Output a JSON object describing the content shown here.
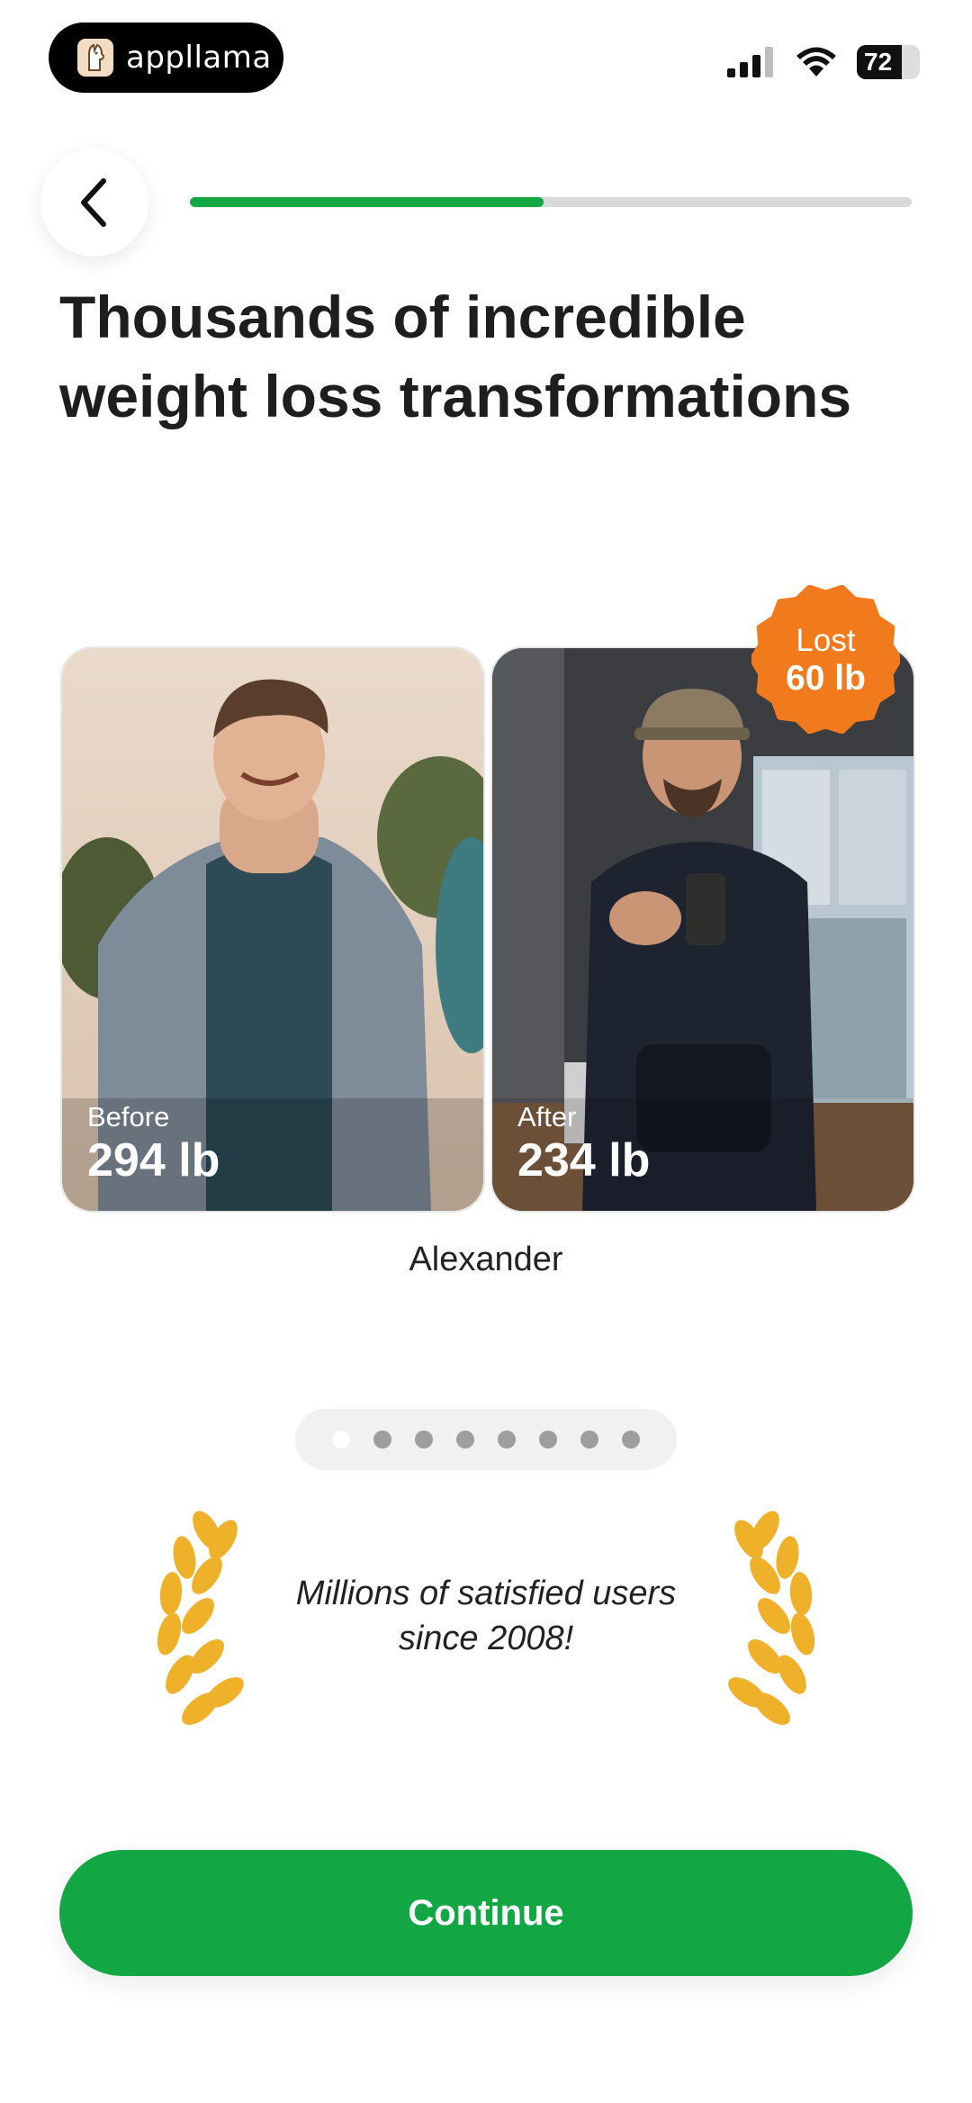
{
  "status_bar": {
    "app_name": "appllama",
    "battery_level": "72",
    "battery_fraction": 0.72
  },
  "header": {
    "progress_fraction": 0.49
  },
  "title": "Thousands of incredible weight loss transformations",
  "transformation": {
    "name": "Alexander",
    "before_label": "Before",
    "before_weight": "294 lb",
    "after_label": "After",
    "after_weight": "234 lb",
    "badge_line1": "Lost",
    "badge_line2": "60 lb"
  },
  "carousel": {
    "total": 8,
    "active_index": 0
  },
  "social_proof": {
    "line1": "Millions of satisfied users",
    "line2": "since 2008!"
  },
  "cta": {
    "continue_label": "Continue"
  },
  "colors": {
    "accent": "#13a645",
    "badge": "#f07a1c",
    "laurel": "#f0b12a"
  },
  "icons": [
    "app-logo-icon",
    "signal-icon",
    "wifi-icon",
    "battery-icon",
    "back-chevron-icon",
    "laurel-icon"
  ]
}
